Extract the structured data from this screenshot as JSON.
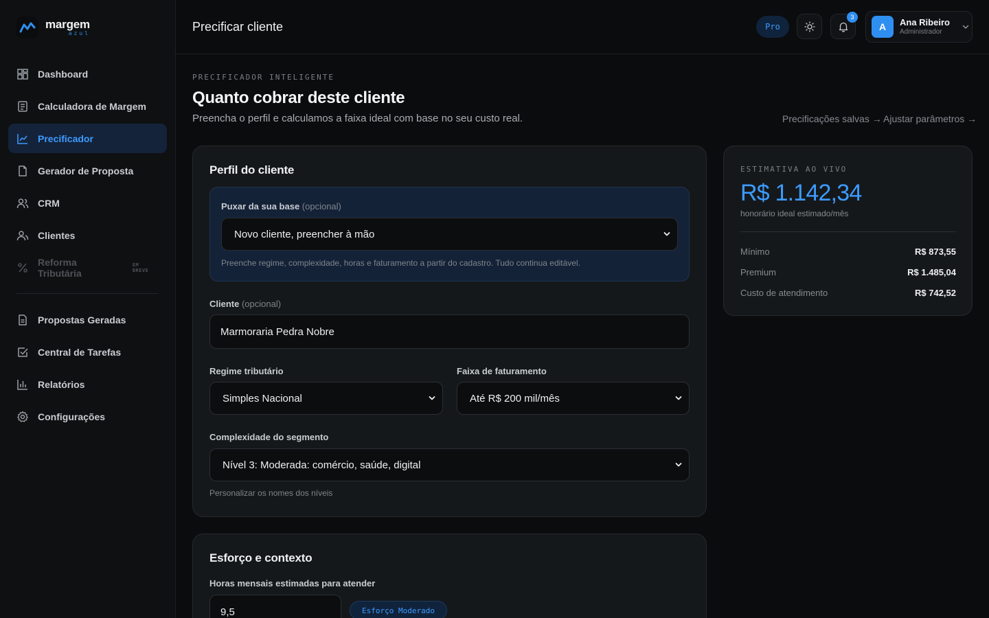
{
  "brand": {
    "name": "margem",
    "sub": "azul"
  },
  "sidebar": {
    "items": [
      {
        "label": "Dashboard",
        "icon": "dashboard-icon"
      },
      {
        "label": "Calculadora de Margem",
        "icon": "calculator-icon"
      },
      {
        "label": "Precificador",
        "icon": "chart-line-icon",
        "active": true
      },
      {
        "label": "Gerador de Proposta",
        "icon": "document-icon"
      },
      {
        "label": "CRM",
        "icon": "users-icon"
      },
      {
        "label": "Clientes",
        "icon": "clients-icon"
      },
      {
        "label": "Reforma Tributária",
        "icon": "percent-icon",
        "badge": "EM BREVE",
        "disabled": true
      }
    ],
    "items2": [
      {
        "label": "Propostas Geradas",
        "icon": "file-list-icon"
      },
      {
        "label": "Central de Tarefas",
        "icon": "check-square-icon"
      },
      {
        "label": "Relatórios",
        "icon": "bar-chart-icon"
      },
      {
        "label": "Configurações",
        "icon": "gear-icon"
      }
    ]
  },
  "header": {
    "title": "Precificar cliente",
    "plan": "Pro",
    "notifications": "3",
    "user": {
      "initial": "A",
      "name": "Ana Ribeiro",
      "role": "Administrador"
    }
  },
  "main": {
    "eyebrow": "PRECIFICADOR INTELIGENTE",
    "title": "Quanto cobrar deste cliente",
    "subtitle": "Preencha o perfil e calculamos a faixa ideal com base no seu custo real.",
    "links": [
      "Precificações salvas →",
      "Ajustar parâmetros →"
    ]
  },
  "profile": {
    "title": "Perfil do cliente",
    "import": {
      "label": "Puxar da sua base",
      "label_opt": "(opcional)",
      "value": "Novo cliente, preencher à mão",
      "hint": "Preenche regime, complexidade, horas e faturamento a partir do cadastro. Tudo continua editável."
    },
    "client": {
      "label": "Cliente",
      "label_opt": "(opcional)",
      "value": "Marmoraria Pedra Nobre"
    },
    "regime": {
      "label": "Regime tributário",
      "value": "Simples Nacional"
    },
    "revenue": {
      "label": "Faixa de faturamento",
      "value": "Até R$ 200 mil/mês"
    },
    "complexity": {
      "label": "Complexidade do segmento",
      "value": "Nível 3: Moderada: comércio, saúde, digital",
      "hint": "Personalizar os nomes dos níveis"
    }
  },
  "effort": {
    "title": "Esforço e contexto",
    "hours_label": "Horas mensais estimadas para atender",
    "hours_value": "9,5",
    "pill": "Esforço Moderado"
  },
  "estimate": {
    "label": "ESTIMATIVA AO VIVO",
    "value": "R$ 1.142,34",
    "note": "honorário ideal estimado/mês",
    "rows": [
      {
        "k": "Mínimo",
        "v": "R$ 873,55"
      },
      {
        "k": "Premium",
        "v": "R$ 1.485,04"
      },
      {
        "k": "Custo de atendimento",
        "v": "R$ 742,52"
      }
    ]
  },
  "colors": {
    "accent": "#3d9bff",
    "background": "#0b0c0d",
    "card": "#15181b"
  }
}
